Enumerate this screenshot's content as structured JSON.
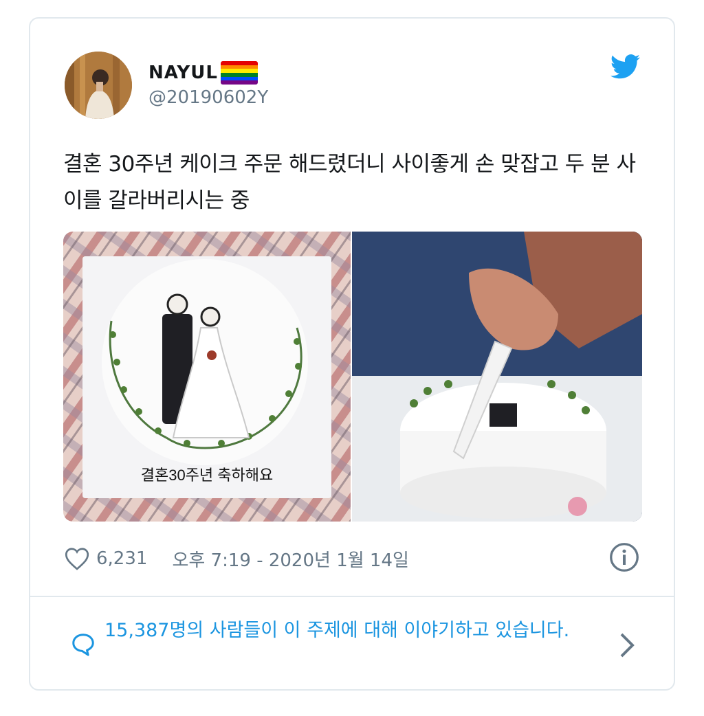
{
  "author": {
    "display_name": "NAYUL",
    "handle": "@20190602Y",
    "flag_icon": "rainbow-flag-icon",
    "flag_colors": [
      "#e40303",
      "#ff8c00",
      "#ffed00",
      "#008026",
      "#004dff",
      "#750787"
    ]
  },
  "tweet": {
    "text": "결혼 30주년 케이크 주문 해드렸더니 사이좋게 손 맞잡고 두 분 사이를 갈라버리시는 중",
    "cake_inscription": "결혼30주년 축하해요"
  },
  "stats": {
    "like_icon": "heart-icon",
    "likes": "6,231",
    "timestamp": "오후 7:19 - 2020년 1월 14일",
    "info_icon": "info-icon"
  },
  "conversation": {
    "icon": "speech-bubble-icon",
    "text": "15,387명의 사람들이 이 주제에 대해 이야기하고 있습니다.",
    "chevron_icon": "chevron-right-icon"
  },
  "colors": {
    "twitter_blue": "#1da1f2",
    "link_blue": "#1b95e0",
    "secondary_text": "#657786",
    "border": "#e1e8ed"
  }
}
